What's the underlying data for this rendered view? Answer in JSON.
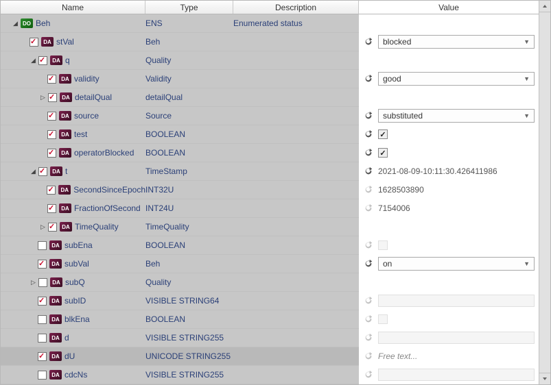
{
  "header": {
    "name": "Name",
    "type": "Type",
    "desc": "Description",
    "value": "Value"
  },
  "rows": [
    {
      "indent": 10,
      "twist": "open",
      "chk": null,
      "badge": "DO",
      "name": "Beh",
      "type": "ENS",
      "desc": "Enumerated status",
      "value": null,
      "refresh": null
    },
    {
      "indent": 36,
      "twist": null,
      "chk": true,
      "badge": "DA",
      "name": "stVal",
      "type": "Beh",
      "desc": "",
      "value": {
        "kind": "select",
        "text": "blocked"
      },
      "refresh": "on"
    },
    {
      "indent": 36,
      "twist": "open",
      "chk": true,
      "badge": "DA",
      "name": "q",
      "type": "Quality",
      "desc": "",
      "value": null,
      "refresh": null
    },
    {
      "indent": 62,
      "twist": null,
      "chk": true,
      "badge": "DA",
      "name": "validity",
      "type": "Validity",
      "desc": "",
      "value": {
        "kind": "select",
        "text": "good"
      },
      "refresh": "on"
    },
    {
      "indent": 50,
      "twist": "closed",
      "chk": true,
      "badge": "DA",
      "name": "detailQual",
      "type": "detailQual",
      "desc": "",
      "value": null,
      "refresh": null
    },
    {
      "indent": 62,
      "twist": null,
      "chk": true,
      "badge": "DA",
      "name": "source",
      "type": "Source",
      "desc": "",
      "value": {
        "kind": "select",
        "text": "substituted"
      },
      "refresh": "on"
    },
    {
      "indent": 62,
      "twist": null,
      "chk": true,
      "badge": "DA",
      "name": "test",
      "type": "BOOLEAN",
      "desc": "",
      "value": {
        "kind": "tick"
      },
      "refresh": "on"
    },
    {
      "indent": 62,
      "twist": null,
      "chk": true,
      "badge": "DA",
      "name": "operatorBlocked",
      "type": "BOOLEAN",
      "desc": "",
      "value": {
        "kind": "tick"
      },
      "refresh": "on"
    },
    {
      "indent": 36,
      "twist": "open",
      "chk": true,
      "badge": "DA",
      "name": "t",
      "type": "TimeStamp",
      "desc": "",
      "value": {
        "kind": "text",
        "text": "2021-08-09-10:11:30.426411986"
      },
      "refresh": "on"
    },
    {
      "indent": 62,
      "twist": null,
      "chk": true,
      "badge": "DA",
      "name": "SecondSinceEpoch",
      "type": "INT32U",
      "desc": "",
      "value": {
        "kind": "text",
        "text": "1628503890"
      },
      "refresh": "dim"
    },
    {
      "indent": 62,
      "twist": null,
      "chk": true,
      "badge": "DA",
      "name": "FractionOfSecond",
      "type": "INT24U",
      "desc": "",
      "value": {
        "kind": "text",
        "text": "7154006"
      },
      "refresh": "dim"
    },
    {
      "indent": 50,
      "twist": "closed",
      "chk": true,
      "badge": "DA",
      "name": "TimeQuality",
      "type": "TimeQuality",
      "desc": "",
      "value": null,
      "refresh": null
    },
    {
      "indent": 48,
      "twist": null,
      "chk": false,
      "badge": "DA",
      "name": "subEna",
      "type": "BOOLEAN",
      "desc": "",
      "value": {
        "kind": "emptycheck"
      },
      "refresh": "dim"
    },
    {
      "indent": 48,
      "twist": null,
      "chk": true,
      "badge": "DA",
      "name": "subVal",
      "type": "Beh",
      "desc": "",
      "value": {
        "kind": "select",
        "text": "on"
      },
      "refresh": "on"
    },
    {
      "indent": 36,
      "twist": "closed",
      "chk": false,
      "badge": "DA",
      "name": "subQ",
      "type": "Quality",
      "desc": "",
      "value": null,
      "refresh": null
    },
    {
      "indent": 48,
      "twist": null,
      "chk": true,
      "badge": "DA",
      "name": "subID",
      "type": "VISIBLE STRING64",
      "desc": "",
      "value": {
        "kind": "emptyinput"
      },
      "refresh": "dim"
    },
    {
      "indent": 48,
      "twist": null,
      "chk": false,
      "badge": "DA",
      "name": "blkEna",
      "type": "BOOLEAN",
      "desc": "",
      "value": {
        "kind": "emptycheck"
      },
      "refresh": "dim"
    },
    {
      "indent": 48,
      "twist": null,
      "chk": false,
      "badge": "DA",
      "name": "d",
      "type": "VISIBLE STRING255",
      "desc": "",
      "value": {
        "kind": "emptyinput"
      },
      "refresh": "dim"
    },
    {
      "indent": 48,
      "twist": null,
      "chk": true,
      "badge": "DA",
      "name": "dU",
      "type": "UNICODE STRING255",
      "desc": "",
      "value": {
        "kind": "freetext",
        "text": "Free text..."
      },
      "refresh": "dim",
      "sel": true
    },
    {
      "indent": 48,
      "twist": null,
      "chk": false,
      "badge": "DA",
      "name": "cdcNs",
      "type": "VISIBLE STRING255",
      "desc": "",
      "value": {
        "kind": "emptyinput"
      },
      "refresh": "dim"
    }
  ]
}
